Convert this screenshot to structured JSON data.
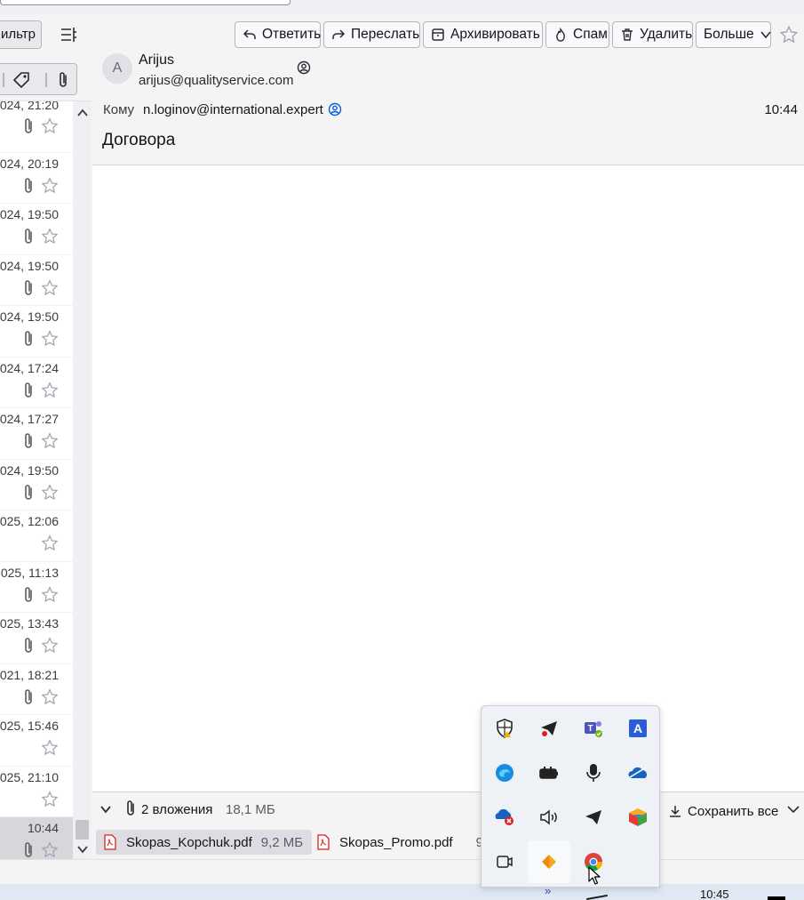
{
  "left_pane": {
    "filter_label": "ильтр",
    "messages": [
      {
        "date": "024, 21:20",
        "attachment": true
      },
      {
        "date": "024, 20:19",
        "attachment": true
      },
      {
        "date": "024, 19:50",
        "attachment": true
      },
      {
        "date": "024, 19:50",
        "attachment": true
      },
      {
        "date": "024, 19:50",
        "attachment": true
      },
      {
        "date": "024, 17:24",
        "attachment": true
      },
      {
        "date": "024, 17:27",
        "attachment": true
      },
      {
        "date": "024, 19:50",
        "attachment": true
      },
      {
        "date": "025, 12:06",
        "attachment": false
      },
      {
        "date": "025, 11:13",
        "attachment": true
      },
      {
        "date": "025, 13:43",
        "attachment": true
      },
      {
        "date": "021, 18:21",
        "attachment": true
      },
      {
        "date": "025, 15:46",
        "attachment": false
      },
      {
        "date": "025, 21:10",
        "attachment": false
      },
      {
        "date": "10:44",
        "attachment": true,
        "selected": true
      }
    ]
  },
  "toolbar": {
    "reply": "Ответить",
    "forward": "Переслать",
    "archive": "Архивировать",
    "spam": "Спам",
    "delete": "Удалить",
    "more": "Больше"
  },
  "message": {
    "avatar_letter": "A",
    "from_name": "Arijus",
    "from_email": "arijus@qualityservice.com",
    "to_label": "Кому",
    "to_address": "n.loginov@international.expert",
    "time": "10:44",
    "subject": "Договора"
  },
  "attachments": {
    "count_label": "2 вложения",
    "total_size": "18,1 МБ",
    "save_all": "Сохранить все",
    "items": [
      {
        "name": "Skopas_Kopchuk.pdf",
        "size": "9,2 МБ"
      },
      {
        "name": "Skopas_Promo.pdf",
        "size": "9"
      }
    ]
  },
  "taskbar": {
    "clock": "10:45",
    "overflow": "»"
  },
  "tray_icons": [
    "windows-security-icon",
    "telegram-icon",
    "teams-icon",
    "font-a-icon",
    "edge-update-icon",
    "battery-icon",
    "microphone-icon",
    "onedrive-icon",
    "onedrive-error-icon",
    "speaker-icon",
    "telegram-icon",
    "bluestacks-icon",
    "meet-now-icon",
    "anydesk-icon",
    "google-chrome-icon"
  ],
  "colors": {
    "accent_blue": "#0060df",
    "pdf_red": "#d92215",
    "selected_row": "#d7d7db"
  }
}
